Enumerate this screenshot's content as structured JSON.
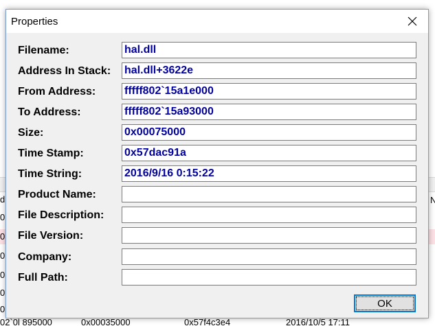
{
  "dialog": {
    "title": "Properties",
    "ok_label": "OK",
    "fields": [
      {
        "label": "Filename:",
        "value": "hal.dll"
      },
      {
        "label": "Address In Stack:",
        "value": "hal.dll+3622e"
      },
      {
        "label": "From Address:",
        "value": "fffff802`15a1e000"
      },
      {
        "label": "To Address:",
        "value": "fffff802`15a93000"
      },
      {
        "label": "Size:",
        "value": "0x00075000"
      },
      {
        "label": "Time Stamp:",
        "value": "0x57dac91a"
      },
      {
        "label": "Time String:",
        "value": "2016/9/16 0:15:22"
      },
      {
        "label": "Product Name:",
        "value": ""
      },
      {
        "label": "File Description:",
        "value": ""
      },
      {
        "label": "File Version:",
        "value": ""
      },
      {
        "label": "Company:",
        "value": ""
      },
      {
        "label": "Full Path:",
        "value": ""
      }
    ]
  },
  "background": {
    "left_chars": [
      "d",
      "0",
      "0",
      "0",
      "0",
      "0",
      "0",
      "0"
    ],
    "right_char": "N",
    "bottom_row": [
      "02`0l 895000",
      "0x00035000",
      "0x57f4c3e4",
      "2016/10/5 17:11"
    ]
  },
  "colors": {
    "value_text": "#0000a0",
    "ok_focus_border": "#0078d7",
    "dialog_face": "#f0f0f0"
  },
  "icons": {
    "close": "close-icon"
  }
}
